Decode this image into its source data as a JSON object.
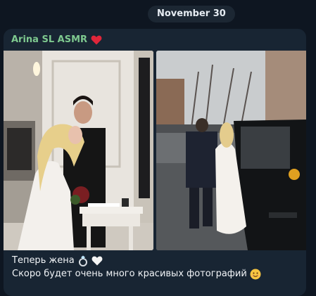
{
  "date_separator": "November 30",
  "message": {
    "sender": "Arina SL ASMR",
    "sender_emoji": "red-heart-icon",
    "photos": [
      {
        "name": "wedding-signing-photo"
      },
      {
        "name": "street-walk-photo"
      }
    ],
    "caption_line_1": "Теперь жена",
    "caption_line_1_emojis": [
      "ring-icon",
      "white-heart-icon"
    ],
    "caption_line_2": "Скоро будет очень много красивых фотографий",
    "caption_line_2_emoji": "smile-emoji-icon"
  },
  "colors": {
    "background": "#0e1621",
    "bubble": "#182533",
    "sender_name": "#7ec98f",
    "date_pill": "#1c2733"
  }
}
